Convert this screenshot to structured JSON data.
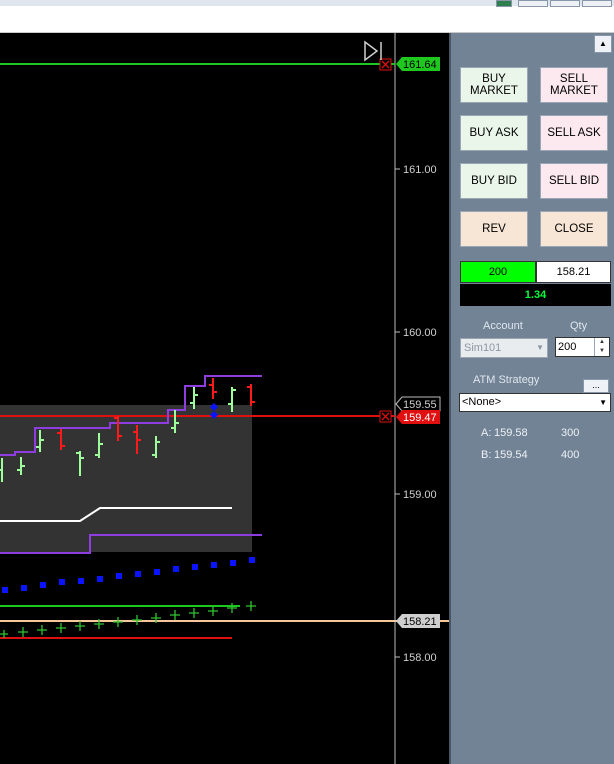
{
  "chart": {
    "y_axis_labels": [
      "161.00",
      "160.00",
      "159.00",
      "158.00"
    ],
    "price_markers": {
      "target": "161.64",
      "last": "159.55",
      "stop": "159.47",
      "entry": "158.21"
    },
    "colors": {
      "target_line": "#1ec81e",
      "stop_line": "#e01010",
      "entry_line": "#f5c79a",
      "up_bar": "#9cff9c",
      "down_bar": "#ff1a1a",
      "channel": "#8e3ee0",
      "dots": "#0a14ff",
      "crosses": "#2fc42f"
    },
    "icons": {
      "close_x": "close-icon",
      "play": "play-icon"
    }
  },
  "order_panel": {
    "buttons": {
      "buy_market": "BUY\nMARKET",
      "sell_market": "SELL\nMARKET",
      "buy_ask": "BUY ASK",
      "sell_ask": "SELL ASK",
      "buy_bid": "BUY BID",
      "sell_bid": "SELL BID",
      "rev": "REV",
      "close": "CLOSE"
    },
    "position": {
      "quantity": "200",
      "avg_price": "158.21",
      "pnl": "1.34"
    },
    "account_label": "Account",
    "account_value": "Sim101",
    "qty_label": "Qty",
    "qty_value": "200",
    "atm_label": "ATM Strategy",
    "atm_button": "...",
    "atm_value": "<None>",
    "ask_line": {
      "label": "A:",
      "price": "159.58",
      "size": "300"
    },
    "bid_line": {
      "label": "B:",
      "price": "159.54",
      "size": "400"
    }
  }
}
